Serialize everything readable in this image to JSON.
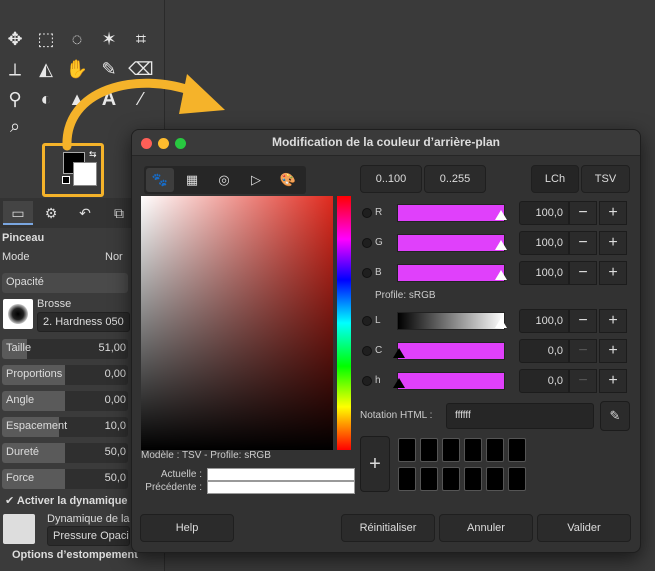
{
  "toolbox": {
    "icons": [
      "move-icon",
      "rect-select-icon",
      "lasso-icon",
      "fuzzy-select-icon",
      "crop-icon",
      "transform-icon",
      "fill-icon",
      "smudge-icon",
      "paintbrush-icon",
      "eraser-icon",
      "heal-icon",
      "dodge-icon",
      "text-icon",
      "color-picker-icon",
      "zoom-icon"
    ],
    "text_tool_glyph": "A"
  },
  "tool_options": {
    "title": "Pinceau",
    "mode_label": "Mode",
    "mode_value": "Nor",
    "opacity_label": "Opacité",
    "brush_label": "Brosse",
    "brush_value": "2. Hardness 050",
    "sliders": [
      {
        "label": "Taille",
        "value": "51,00",
        "fill": 0.2
      },
      {
        "label": "Proportions",
        "value": "0,00",
        "fill": 0.5
      },
      {
        "label": "Angle",
        "value": "0,00",
        "fill": 0.5
      },
      {
        "label": "Espacement",
        "value": "10,0",
        "fill": 0.45
      },
      {
        "label": "Dureté",
        "value": "50,0",
        "fill": 0.5
      },
      {
        "label": "Force",
        "value": "50,0",
        "fill": 0.5
      }
    ],
    "dynamics_label": "Activer la dynamique",
    "dynamics_name": "Dynamique de la",
    "dynamics_value": "Pressure Opaci",
    "stamp_options": "Options d’estompement"
  },
  "dialog": {
    "title": "Modification de la couleur d’arrière-plan",
    "range_buttons": [
      "0..100",
      "0..255"
    ],
    "space_buttons": [
      "LCh",
      "TSV"
    ],
    "model_label": "Modèle : TSV - Profile: sRGB",
    "current_label": "Actuelle :",
    "previous_label": "Précédente :",
    "channels": [
      {
        "label": "R",
        "value": "100,0",
        "minus_disabled": false
      },
      {
        "label": "G",
        "value": "100,0",
        "minus_disabled": false
      },
      {
        "label": "B",
        "value": "100,0",
        "minus_disabled": false
      },
      {
        "label": "L",
        "value": "100,0",
        "minus_disabled": false
      },
      {
        "label": "C",
        "value": "0,0",
        "minus_disabled": true
      },
      {
        "label": "h",
        "value": "0,0",
        "minus_disabled": true
      }
    ],
    "profile_label": "Profile: sRGB",
    "html_label": "Notation HTML :",
    "html_value": "ffffff",
    "buttons": {
      "help": "Help",
      "reset": "Réinitialiser",
      "cancel": "Annuler",
      "ok": "Valider"
    }
  }
}
